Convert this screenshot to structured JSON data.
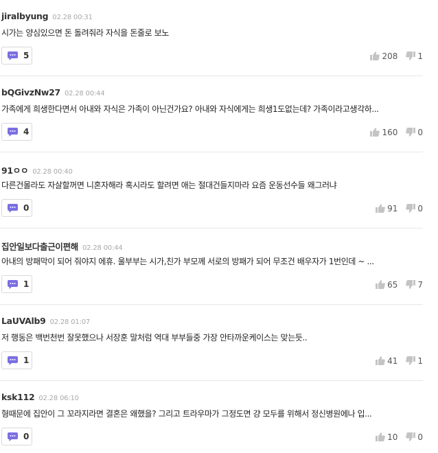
{
  "comments": [
    {
      "user": "jiralbyung",
      "date": "02.28 00:31",
      "text": "시가는 양심있으면 돈 돌려줘라 자식을 돈줄로 보노",
      "replies": "5",
      "likes": "208",
      "dislikes": "1"
    },
    {
      "user": "bQGivzNw27",
      "date": "02.28 00:44",
      "text": "가족에게 희생한다면서 아내와 자식은 가족이 아닌건가요? 아내와 자식에게는 희생1도없는데? 가족이라고생각하...",
      "replies": "4",
      "likes": "160",
      "dislikes": "0"
    },
    {
      "user": "91ㅇㅇ",
      "date": "02.28 00:40",
      "text": "다른건몰라도 자살할꺼면 니혼자해라 혹시라도 할려면 애는 절대건들지마라 요즘 운동선수들 왜그러냐",
      "replies": "0",
      "likes": "91",
      "dislikes": "0"
    },
    {
      "user": "집안일보다출근이편해",
      "date": "02.28 00:44",
      "text": "아내의 방패막이 되어 줘야지 에휴. 울부부는 시가,친가 부모께 서로의 방패가 되어 무조건 배우자가 1번인데 ~ ...",
      "replies": "1",
      "likes": "65",
      "dislikes": "7"
    },
    {
      "user": "LaUVAlb9",
      "date": "02.28 01:07",
      "text": "저 행동은 백번천번 잘못했으나 서장훈 말처럼 역대 부부들중 가장 안타까운케이스는 맞는듯..",
      "replies": "1",
      "likes": "41",
      "dislikes": "1"
    },
    {
      "user": "ksk112",
      "date": "02.28 06:10",
      "text": "형때문에 집안이 그 꼬라지라면 결혼은 왜했을? 그리고 트라우마가 그정도면 걍 모두를 위해서 정신병원에나 입...",
      "replies": "0",
      "likes": "10",
      "dislikes": "0"
    }
  ],
  "colors": {
    "reply_icon": "#7b6fe3",
    "vote_icon": "#c4c4c4",
    "divider": "#e6e6e6"
  },
  "icons": {
    "reply": "speech-bubble-icon",
    "like": "thumbs-up-icon",
    "dislike": "thumbs-down-icon"
  }
}
